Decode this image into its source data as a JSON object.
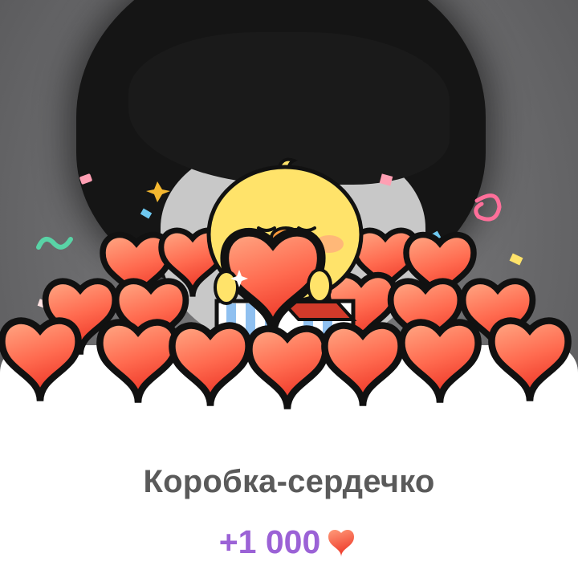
{
  "gift": {
    "title": "Коробка-сердечко",
    "reward_amount": "+1 000",
    "reward_icon": "heart-icon"
  },
  "colors": {
    "title_text": "#5a5a5a",
    "reward_text": "#9b62d6",
    "heart_light": "#ff9b7a",
    "heart_dark": "#ee3a2a",
    "chick": "#ffe36a"
  }
}
